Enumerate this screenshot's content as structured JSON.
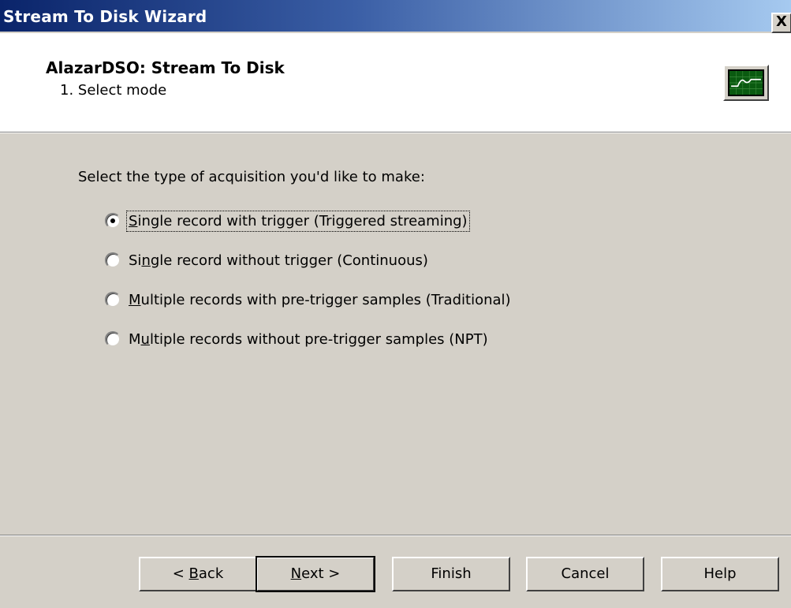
{
  "window": {
    "title": "Stream To Disk Wizard",
    "close_label": "X"
  },
  "header": {
    "title": "AlazarDSO: Stream To Disk",
    "subtitle": "1. Select mode",
    "icon": "oscilloscope-icon"
  },
  "content": {
    "prompt": "Select the type of acquisition you'd like to make:",
    "options": [
      {
        "pre": "",
        "key": "S",
        "post": "ingle record with trigger (Triggered streaming)",
        "selected": true
      },
      {
        "pre": "Si",
        "key": "n",
        "post": "gle record without trigger (Continuous)",
        "selected": false
      },
      {
        "pre": "",
        "key": "M",
        "post": "ultiple records with pre-trigger samples (Traditional)",
        "selected": false
      },
      {
        "pre": "M",
        "key": "u",
        "post": "ltiple records without pre-trigger samples (NPT)",
        "selected": false
      }
    ]
  },
  "buttons": {
    "back": {
      "pre": "< ",
      "key": "B",
      "post": "ack"
    },
    "next": {
      "pre": "",
      "key": "N",
      "post": "ext >"
    },
    "finish": "Finish",
    "cancel": "Cancel",
    "help": "Help"
  }
}
